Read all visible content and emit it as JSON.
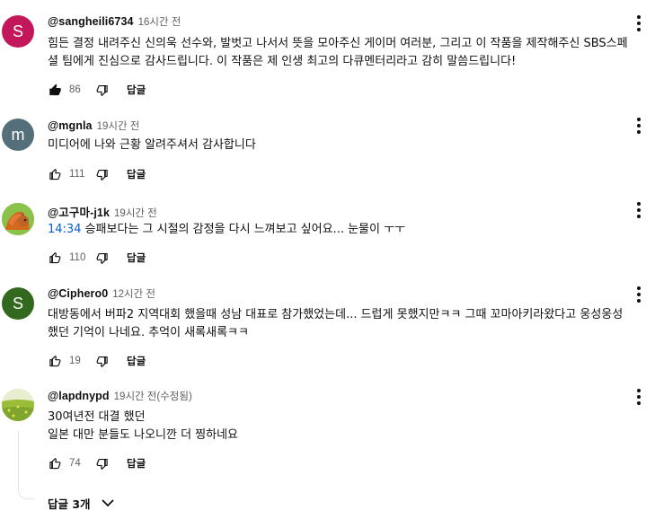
{
  "comments": [
    {
      "avatar_letter": "S",
      "avatar_color": "#c2185b",
      "author": "@sangheili6734",
      "time": "16시간 전",
      "text_lines": [
        "힘든 결정 내려주신 신의욱 선수와, 발벗고 나서서 뜻을 모아주신 게이머 여러분, 그리고 이 작품을 제작해주신 SBS스페",
        "셜 팀에게 진심으로 감사드립니다. 이 작품은 제 인생 최고의 다큐멘터리라고 감히 말씀드립니다!"
      ],
      "likes": "86",
      "liked": true,
      "reply_label": "답글"
    },
    {
      "avatar_letter": "m",
      "avatar_color": "#546e7a",
      "author": "@mgnla",
      "time": "19시간 전",
      "text_lines": [
        "미디어에 나와 근황 알려주셔서 감사합니다"
      ],
      "likes": "111",
      "liked": false,
      "reply_label": "답글"
    },
    {
      "avatar_letter": "",
      "avatar_color": "#7cb342",
      "author": "@고구마-j1k",
      "time": "19시간 전",
      "timestamp_link": "14:34",
      "text_lines": [
        " 승패보다는 그 시절의 감정을 다시 느껴보고 싶어요... 눈물이 ㅜㅜ"
      ],
      "likes": "110",
      "liked": false,
      "reply_label": "답글"
    },
    {
      "avatar_letter": "S",
      "avatar_color": "#33691e",
      "author": "@Ciphero0",
      "time": "12시간 전",
      "text_lines": [
        "대방동에서 버파2 지역대회 했을때 성남 대표로 참가했었는데... 드럽게 못했지만ㅋㅋ 그때 꼬마아키라왔다고 웅성웅성",
        "했던 기억이 나네요. 추억이 새록새록ㅋㅋ"
      ],
      "likes": "19",
      "liked": false,
      "reply_label": "답글"
    },
    {
      "avatar_letter": "",
      "avatar_color": "#a5c24a",
      "author": "@lapdnypd",
      "time": "19시간 전(수정됨)",
      "text_lines": [
        "30여년전 대결 했던",
        "일본 대만 분들도 나오니깐 더 찡하네요"
      ],
      "likes": "74",
      "liked": false,
      "reply_label": "답글"
    }
  ],
  "replies_toggle": {
    "label": "답글 3개"
  }
}
